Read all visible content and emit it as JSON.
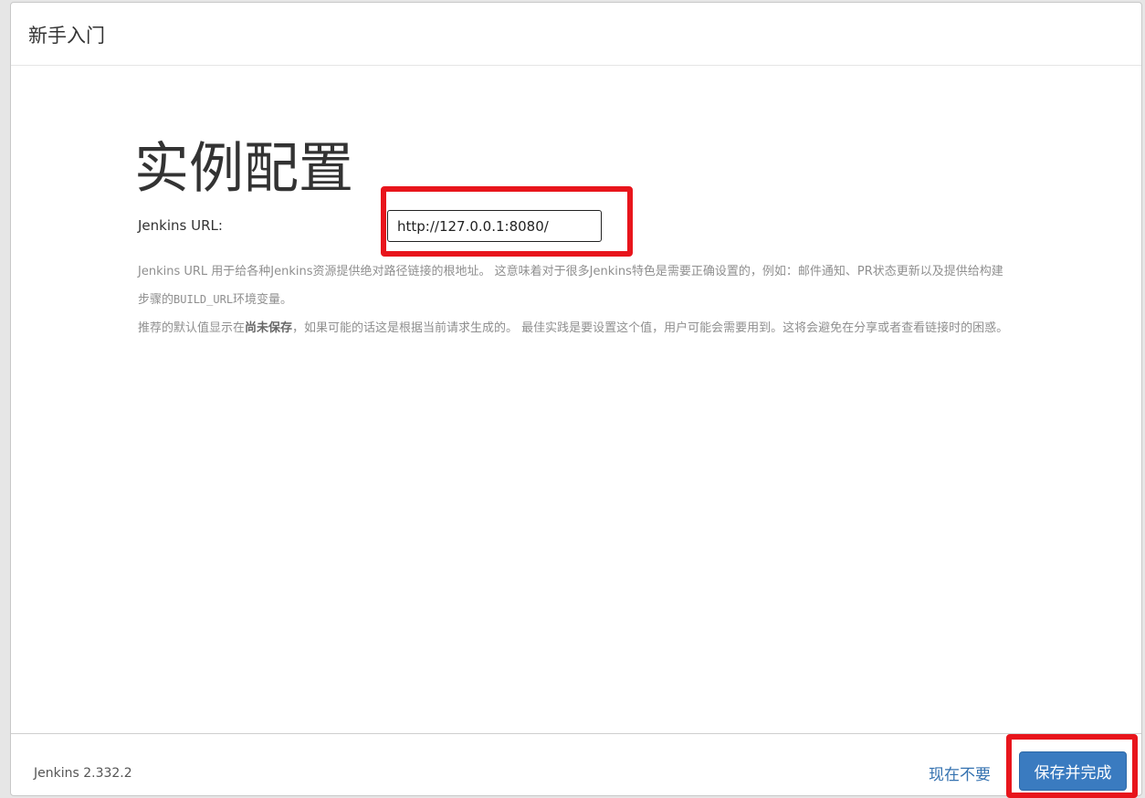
{
  "dialog": {
    "title": "新手入门"
  },
  "main": {
    "heading": "实例配置",
    "url_label": "Jenkins URL:",
    "url_value": "http://127.0.0.1:8080/",
    "help": {
      "p1_part1": "Jenkins URL 用于给各种Jenkins资源提供绝对路径链接的根地址。 这意味着对于很多Jenkins特色是需要正确设置的，例如：邮件通知、PR状态更新以及提供给构建步骤的",
      "p1_code": "BUILD_URL",
      "p1_part2": "环境变量。",
      "p2_part1": "推荐的默认值显示在",
      "p2_strong": "尚未保存",
      "p2_part2": "，如果可能的话这是根据当前请求生成的。 最佳实践是要设置这个值，用户可能会需要用到。这将会避免在分享或者查看链接时的困惑。"
    }
  },
  "footer": {
    "version": "Jenkins 2.332.2",
    "skip_label": "现在不要",
    "save_label": "保存并完成"
  },
  "colors": {
    "highlight": "#e8151c",
    "primary_button": "#3a7bc0",
    "link": "#3572b0"
  }
}
